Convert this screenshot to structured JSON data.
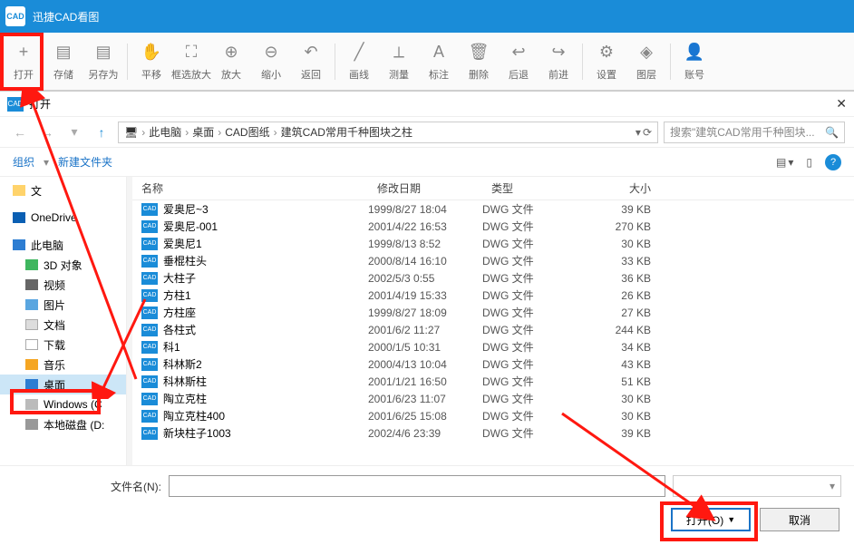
{
  "app": {
    "title": "迅捷CAD看图"
  },
  "toolbar": [
    {
      "label": "打开",
      "icon": "+"
    },
    {
      "label": "存储",
      "icon": "▤"
    },
    {
      "label": "另存为",
      "icon": "▤"
    },
    {
      "sep": true
    },
    {
      "label": "平移",
      "icon": "✋"
    },
    {
      "label": "框选放大",
      "icon": "⛶"
    },
    {
      "label": "放大",
      "icon": "⊕"
    },
    {
      "label": "缩小",
      "icon": "⊖"
    },
    {
      "label": "返回",
      "icon": "↶"
    },
    {
      "sep": true
    },
    {
      "label": "画线",
      "icon": "╱"
    },
    {
      "label": "测量",
      "icon": "⟂"
    },
    {
      "label": "标注",
      "icon": "A"
    },
    {
      "label": "删除",
      "icon": "🗑"
    },
    {
      "label": "后退",
      "icon": "↩"
    },
    {
      "label": "前进",
      "icon": "↪"
    },
    {
      "sep": true
    },
    {
      "label": "设置",
      "icon": "⚙"
    },
    {
      "label": "图层",
      "icon": "◈"
    },
    {
      "sep": true
    },
    {
      "label": "账号",
      "icon": "👤"
    }
  ],
  "dialog": {
    "title": "打开",
    "breadcrumb": [
      "此电脑",
      "桌面",
      "CAD图纸",
      "建筑CAD常用千种图块之柱"
    ],
    "search_placeholder": "搜索\"建筑CAD常用千种图块...",
    "organize": "组织",
    "newfolder": "新建文件夹",
    "tree": [
      {
        "label": "文",
        "cls": "ic-folder",
        "lvl": 1
      },
      {
        "label": "OneDrive",
        "cls": "ic-cloud",
        "lvl": 1
      },
      {
        "label": "此电脑",
        "cls": "ic-pc",
        "lvl": 1
      },
      {
        "label": "3D 对象",
        "cls": "ic-3d",
        "lvl": 2
      },
      {
        "label": "视频",
        "cls": "ic-vid",
        "lvl": 2
      },
      {
        "label": "图片",
        "cls": "ic-pic",
        "lvl": 2
      },
      {
        "label": "文档",
        "cls": "ic-doc",
        "lvl": 2
      },
      {
        "label": "下载",
        "cls": "ic-dl",
        "lvl": 2
      },
      {
        "label": "音乐",
        "cls": "ic-mus",
        "lvl": 2
      },
      {
        "label": "桌面",
        "cls": "ic-desk",
        "lvl": 2,
        "sel": true
      },
      {
        "label": "Windows (C",
        "cls": "ic-win",
        "lvl": 2
      },
      {
        "label": "本地磁盘 (D:",
        "cls": "ic-disk",
        "lvl": 2
      }
    ],
    "columns": {
      "name": "名称",
      "date": "修改日期",
      "type": "类型",
      "size": "大小"
    },
    "files": [
      {
        "name": "爱奥尼~3",
        "date": "1999/8/27 18:04",
        "type": "DWG 文件",
        "size": "39 KB"
      },
      {
        "name": "爱奥尼-001",
        "date": "2001/4/22 16:53",
        "type": "DWG 文件",
        "size": "270 KB"
      },
      {
        "name": "爱奥尼1",
        "date": "1999/8/13 8:52",
        "type": "DWG 文件",
        "size": "30 KB"
      },
      {
        "name": "垂棍柱头",
        "date": "2000/8/14 16:10",
        "type": "DWG 文件",
        "size": "33 KB"
      },
      {
        "name": "大柱子",
        "date": "2002/5/3 0:55",
        "type": "DWG 文件",
        "size": "36 KB"
      },
      {
        "name": "方柱1",
        "date": "2001/4/19 15:33",
        "type": "DWG 文件",
        "size": "26 KB"
      },
      {
        "name": "方柱座",
        "date": "1999/8/27 18:09",
        "type": "DWG 文件",
        "size": "27 KB"
      },
      {
        "name": "各柱式",
        "date": "2001/6/2 11:27",
        "type": "DWG 文件",
        "size": "244 KB"
      },
      {
        "name": "科1",
        "date": "2000/1/5 10:31",
        "type": "DWG 文件",
        "size": "34 KB"
      },
      {
        "name": "科林斯2",
        "date": "2000/4/13 10:04",
        "type": "DWG 文件",
        "size": "43 KB"
      },
      {
        "name": "科林斯柱",
        "date": "2001/1/21 16:50",
        "type": "DWG 文件",
        "size": "51 KB"
      },
      {
        "name": "陶立克柱",
        "date": "2001/6/23 11:07",
        "type": "DWG 文件",
        "size": "30 KB"
      },
      {
        "name": "陶立克柱400",
        "date": "2001/6/25 15:08",
        "type": "DWG 文件",
        "size": "30 KB"
      },
      {
        "name": "新块柱子1003",
        "date": "2002/4/6 23:39",
        "type": "DWG 文件",
        "size": "39 KB"
      }
    ],
    "filename_label": "文件名(N):",
    "filename_value": "",
    "filter": "",
    "open_btn": "打开(O)",
    "cancel_btn": "取消"
  }
}
